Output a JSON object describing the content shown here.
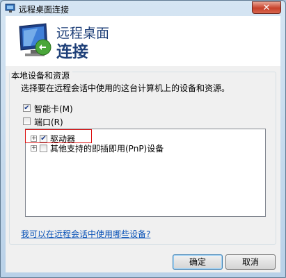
{
  "window": {
    "title": "远程桌面连接",
    "close_label": "✕"
  },
  "header": {
    "line1": "远程桌面",
    "line2": "连接"
  },
  "group": {
    "title": "本地设备和资源",
    "description": "选择要在远程会话中使用的这台计算机上的设备和资源。"
  },
  "options": [
    {
      "label": "智能卡(M)",
      "checked": true
    },
    {
      "label": "端口(R)",
      "checked": false
    }
  ],
  "tree": [
    {
      "expander": "+",
      "label": "驱动器",
      "checked": true
    },
    {
      "expander": "+",
      "label": "其他支持的即插即用(PnP)设备",
      "checked": false
    }
  ],
  "link": "我可以在远程会话中使用哪些设备?",
  "buttons": {
    "ok": "确定",
    "cancel": "取消"
  },
  "colors": {
    "accent_text": "#1e3f78",
    "link": "#0a53b8",
    "highlight_box": "#dd1111"
  }
}
